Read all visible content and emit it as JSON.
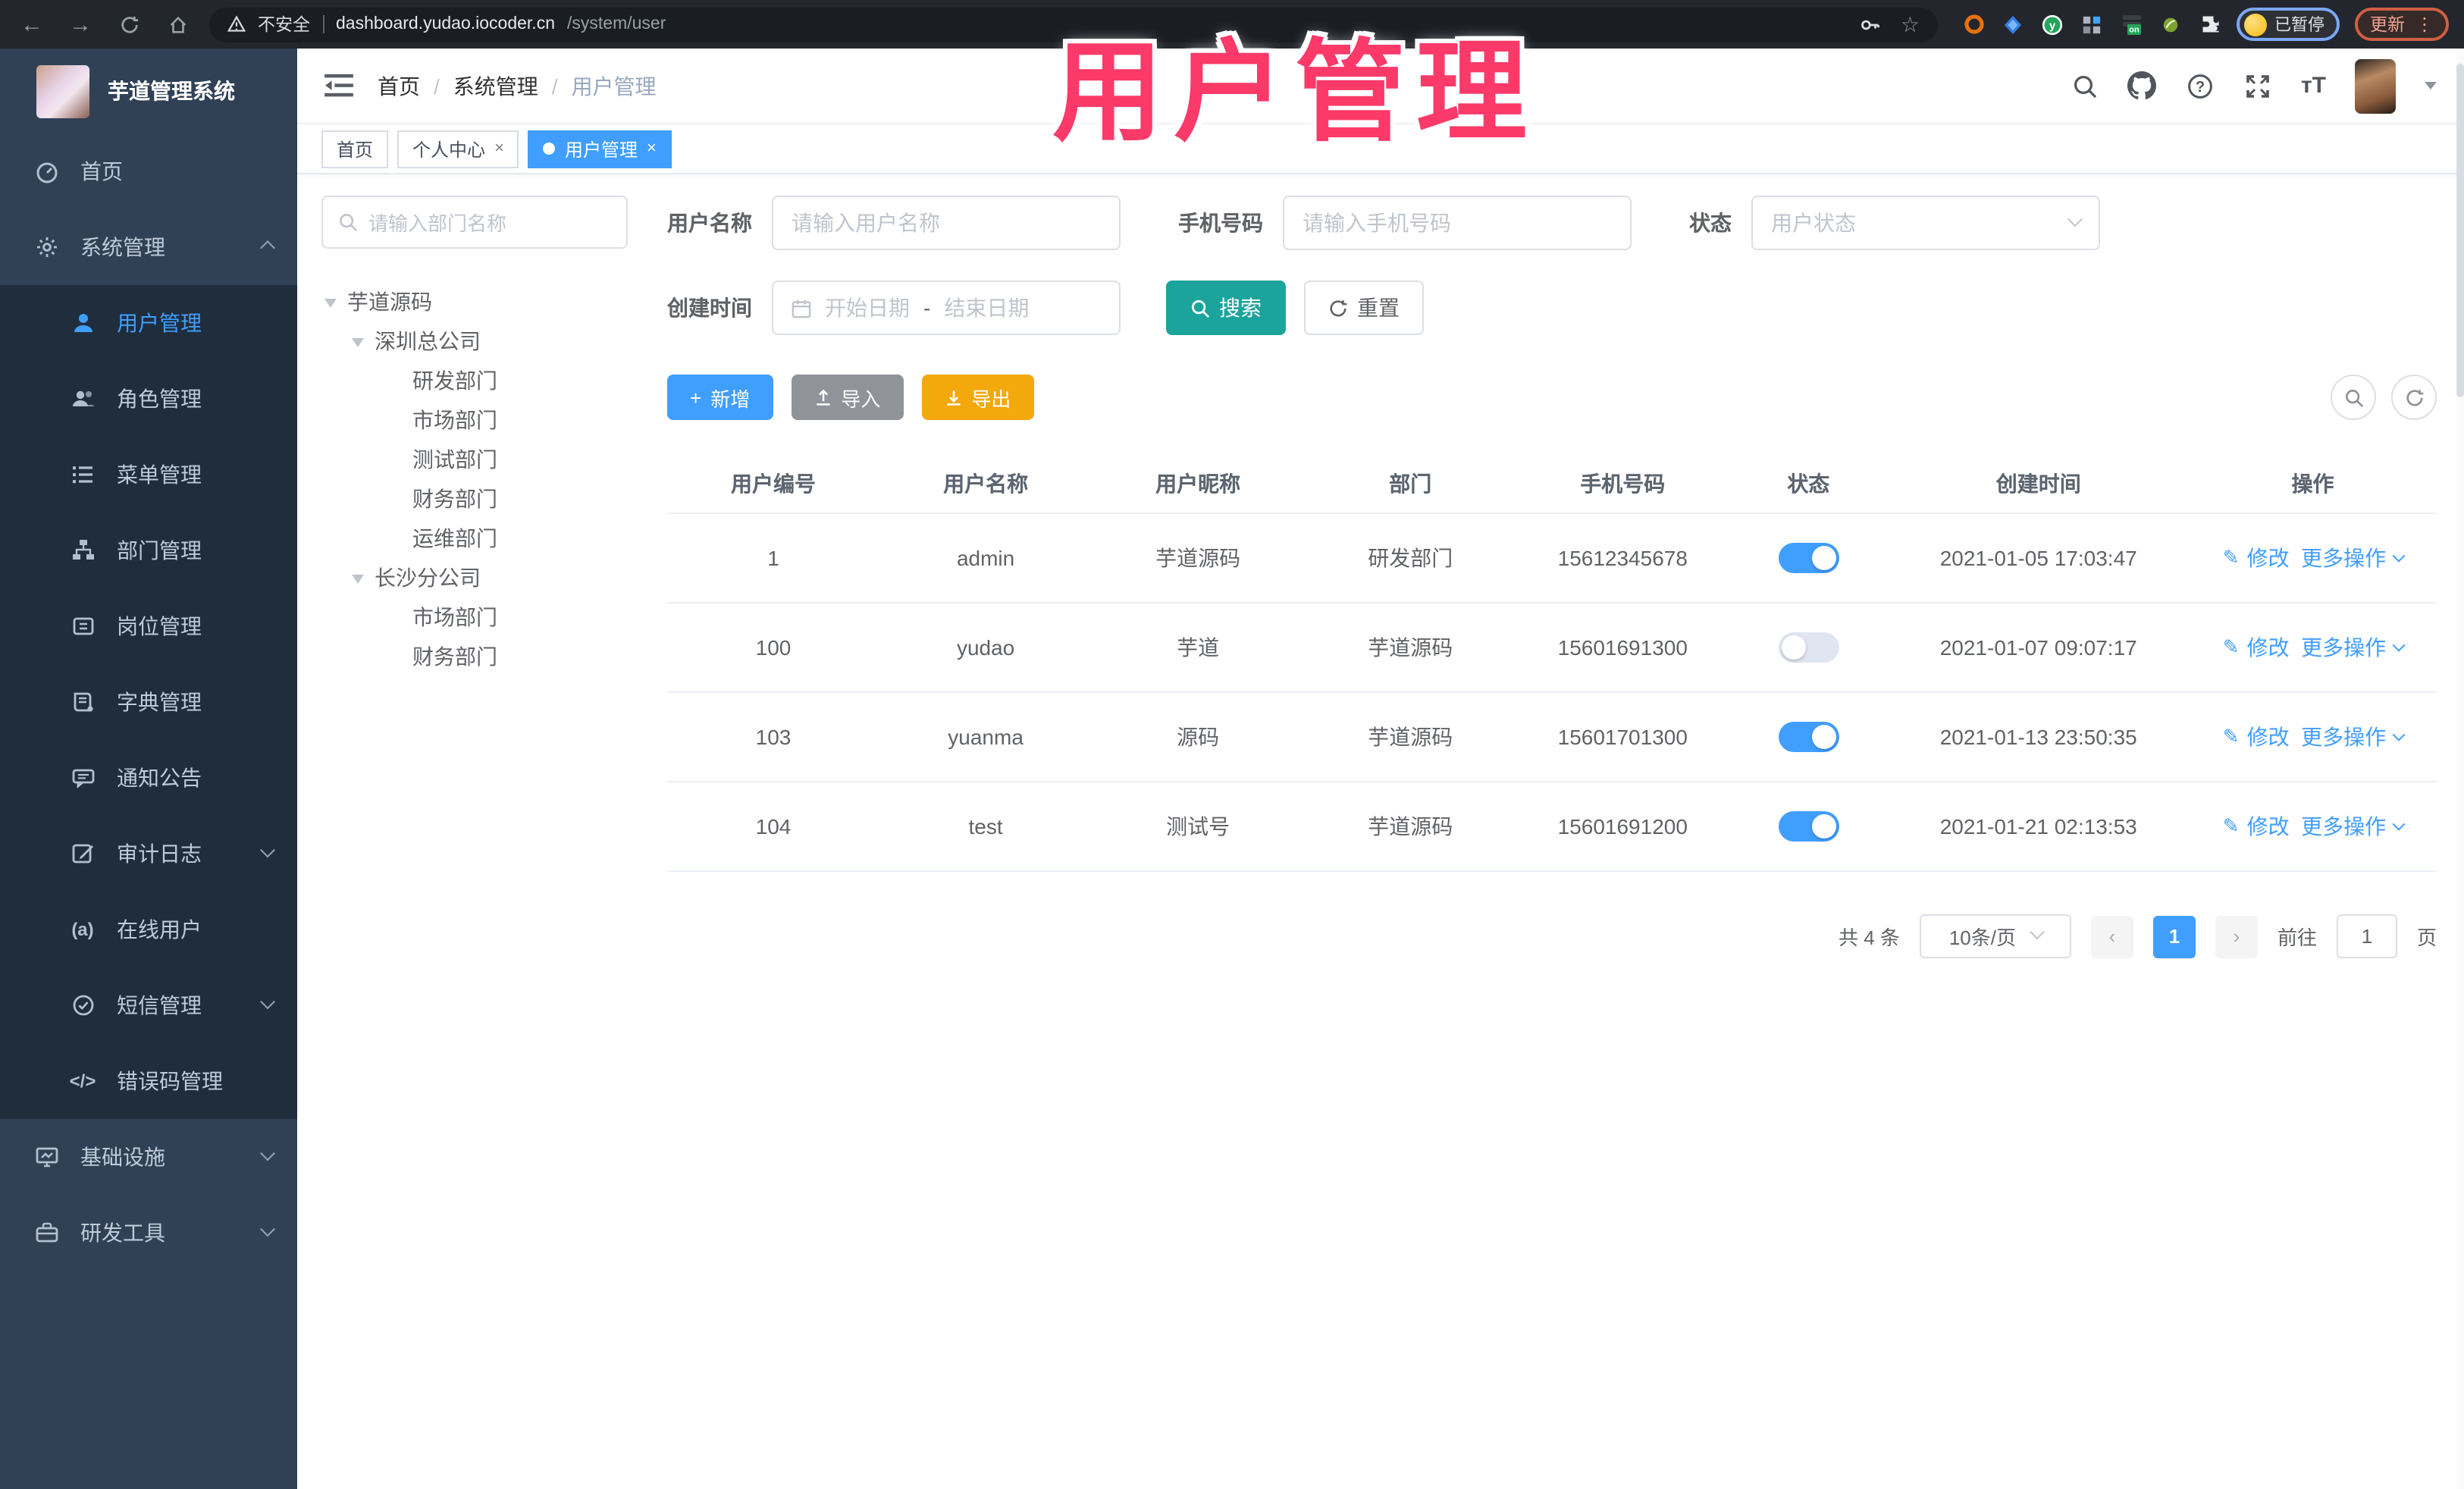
{
  "browser": {
    "security_label": "不安全",
    "url_host": "dashboard.yudao.iocoder.cn",
    "url_path": "/system/user",
    "profile_label": "已暂停",
    "update_label": "更新"
  },
  "overlay_title": "用户管理",
  "sidebar": {
    "logo_title": "芋道管理系统",
    "items": [
      {
        "label": "首页",
        "icon": "dashboard-icon"
      },
      {
        "label": "系统管理",
        "icon": "gear-icon"
      },
      {
        "label": "用户管理",
        "icon": "user-icon",
        "active": true
      },
      {
        "label": "角色管理",
        "icon": "users-icon"
      },
      {
        "label": "菜单管理",
        "icon": "list-icon"
      },
      {
        "label": "部门管理",
        "icon": "org-tree-icon"
      },
      {
        "label": "岗位管理",
        "icon": "badge-icon"
      },
      {
        "label": "字典管理",
        "icon": "book-icon"
      },
      {
        "label": "通知公告",
        "icon": "announcement-icon"
      },
      {
        "label": "审计日志",
        "icon": "edit-log-icon"
      },
      {
        "label": "在线用户",
        "icon": "online-icon"
      },
      {
        "label": "短信管理",
        "icon": "shield-check-icon"
      },
      {
        "label": "错误码管理",
        "icon": "code-icon"
      },
      {
        "label": "基础设施",
        "icon": "monitor-icon"
      },
      {
        "label": "研发工具",
        "icon": "toolbox-icon"
      }
    ]
  },
  "navbar": {
    "breadcrumb": [
      "首页",
      "系统管理",
      "用户管理"
    ],
    "separator": "/"
  },
  "tabs": [
    {
      "label": "首页"
    },
    {
      "label": "个人中心",
      "close": "×"
    },
    {
      "label": "用户管理",
      "close": "×",
      "active": true
    }
  ],
  "dept": {
    "search_placeholder": "请输入部门名称",
    "tree": [
      {
        "label": "芋道源码",
        "depth": 0
      },
      {
        "label": "深圳总公司",
        "depth": 1
      },
      {
        "label": "研发部门",
        "depth": 2
      },
      {
        "label": "市场部门",
        "depth": 2
      },
      {
        "label": "测试部门",
        "depth": 2
      },
      {
        "label": "财务部门",
        "depth": 2
      },
      {
        "label": "运维部门",
        "depth": 2
      },
      {
        "label": "长沙分公司",
        "depth": 1
      },
      {
        "label": "市场部门",
        "depth": 2
      },
      {
        "label": "财务部门",
        "depth": 2
      }
    ]
  },
  "filters": {
    "username_label": "用户名称",
    "username_placeholder": "请输入用户名称",
    "mobile_label": "手机号码",
    "mobile_placeholder": "请输入手机号码",
    "status_label": "状态",
    "status_placeholder": "用户状态",
    "create_time_label": "创建时间",
    "start_placeholder": "开始日期",
    "range_separator": "-",
    "end_placeholder": "结束日期",
    "search_label": "搜索",
    "reset_label": "重置"
  },
  "toolbar": {
    "add_label": "新增",
    "import_label": "导入",
    "export_label": "导出"
  },
  "table": {
    "columns": [
      "用户编号",
      "用户名称",
      "用户昵称",
      "部门",
      "手机号码",
      "状态",
      "创建时间",
      "操作"
    ],
    "action_edit": "修改",
    "action_more": "更多操作",
    "rows": [
      {
        "id": "1",
        "username": "admin",
        "nickname": "芋道源码",
        "dept": "研发部门",
        "mobile": "15612345678",
        "status": "on",
        "created": "2021-01-05 17:03:47"
      },
      {
        "id": "100",
        "username": "yudao",
        "nickname": "芋道",
        "dept": "芋道源码",
        "mobile": "15601691300",
        "status": "off",
        "created": "2021-01-07 09:07:17"
      },
      {
        "id": "103",
        "username": "yuanma",
        "nickname": "源码",
        "dept": "芋道源码",
        "mobile": "15601701300",
        "status": "on",
        "created": "2021-01-13 23:50:35"
      },
      {
        "id": "104",
        "username": "test",
        "nickname": "测试号",
        "dept": "芋道源码",
        "mobile": "15601691200",
        "status": "on",
        "created": "2021-01-21 02:13:53"
      }
    ]
  },
  "pagination": {
    "total_label": "共 4 条",
    "page_size": "10条/页",
    "prev": "‹",
    "next": "›",
    "current_page": "1",
    "goto_label": "前往",
    "goto_value": "1",
    "page_unit": "页"
  },
  "colors": {
    "accent": "#409EFF",
    "search_button": "#1AA49B",
    "export_button": "#F3A80C",
    "import_button": "#909399",
    "overlay_title": "#FB3A6A",
    "sidebar_bg": "#304156",
    "submenu_bg": "#1F2D3D"
  }
}
